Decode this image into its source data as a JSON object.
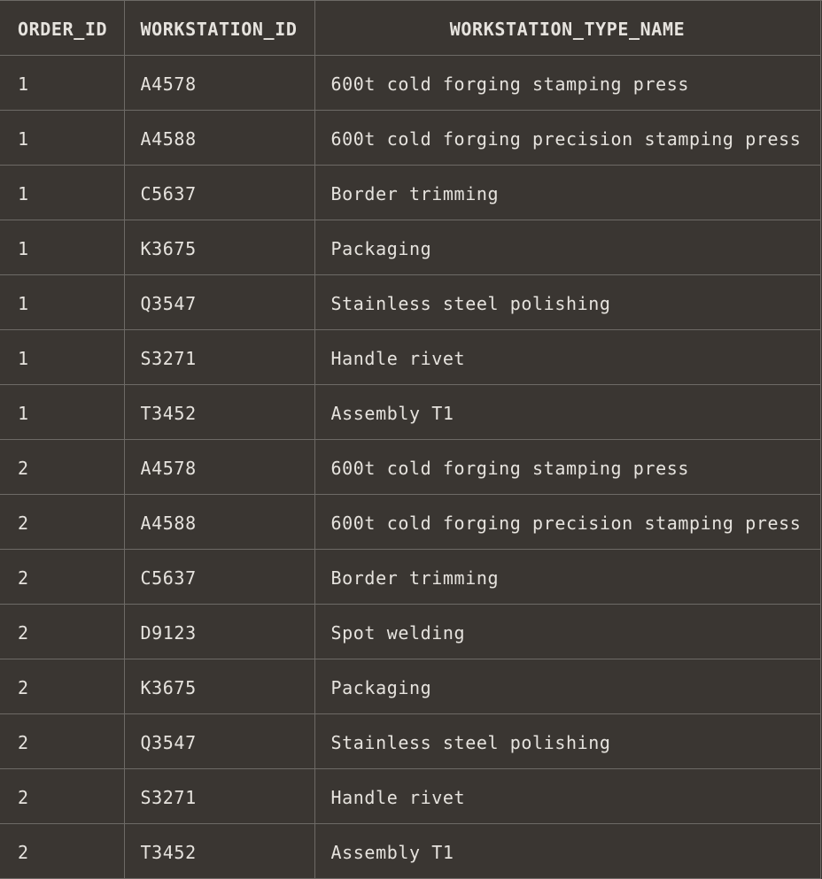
{
  "table": {
    "columns": [
      "ORDER_ID",
      "WORKSTATION_ID",
      "WORKSTATION_TYPE_NAME"
    ],
    "rows": [
      [
        "1",
        "A4578",
        "600t cold forging stamping press"
      ],
      [
        "1",
        "A4588",
        "600t cold forging precision stamping press"
      ],
      [
        "1",
        "C5637",
        "Border trimming"
      ],
      [
        "1",
        "K3675",
        "Packaging"
      ],
      [
        "1",
        "Q3547",
        "Stainless steel polishing"
      ],
      [
        "1",
        "S3271",
        "Handle rivet"
      ],
      [
        "1",
        "T3452",
        "Assembly T1"
      ],
      [
        "2",
        "A4578",
        "600t cold forging stamping press"
      ],
      [
        "2",
        "A4588",
        "600t cold forging precision stamping press"
      ],
      [
        "2",
        "C5637",
        "Border trimming"
      ],
      [
        "2",
        "D9123",
        "Spot welding"
      ],
      [
        "2",
        "K3675",
        "Packaging"
      ],
      [
        "2",
        "Q3547",
        "Stainless steel polishing"
      ],
      [
        "2",
        "S3271",
        "Handle rivet"
      ],
      [
        "2",
        "T3452",
        "Assembly T1"
      ]
    ]
  },
  "colors": {
    "background": "#3a3632",
    "grid_line": "#6d6a66",
    "text": "#e6e3de"
  }
}
